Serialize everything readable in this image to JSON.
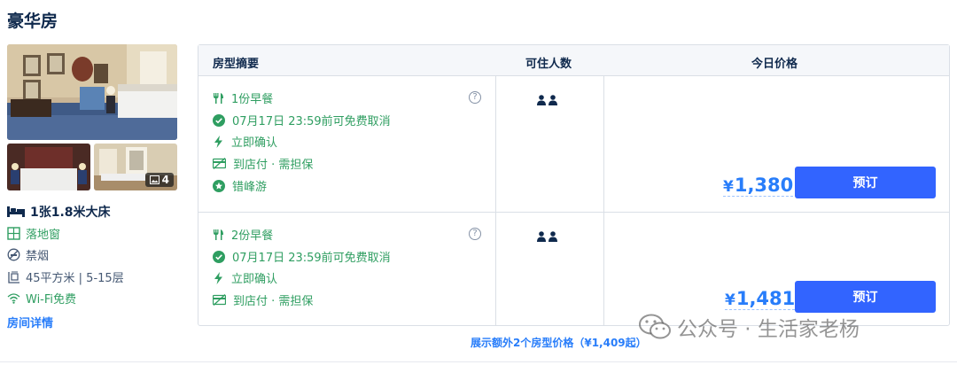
{
  "room": {
    "title": "豪华房",
    "photo_count": "4",
    "bed": "1张1.8米大床",
    "features": [
      {
        "icon": "window-icon",
        "text": "落地窗",
        "color": "#2f9e61"
      },
      {
        "icon": "no-smoking-icon",
        "text": "禁烟",
        "color": "#455873"
      },
      {
        "icon": "area-icon",
        "text": "45平方米 | 5-15层",
        "color": "#455873"
      },
      {
        "icon": "wifi-icon",
        "text": "Wi-Fi免费",
        "color": "#2f9e61"
      }
    ],
    "details_link": "房间详情"
  },
  "table": {
    "headers": {
      "summary": "房型摘要",
      "guests": "可住人数",
      "price": "今日价格"
    },
    "rows": [
      {
        "policies": [
          {
            "icon": "fork-knife-icon",
            "text": "1份早餐"
          },
          {
            "icon": "check-circle-icon",
            "text": "07月17日 23:59前可免费取消"
          },
          {
            "icon": "lightning-icon",
            "text": "立即确认"
          },
          {
            "icon": "no-card-icon",
            "text": "到店付 · 需担保"
          },
          {
            "icon": "star-badge-icon",
            "text": "错峰游"
          }
        ],
        "help": "?",
        "guest_count": 2,
        "currency": "¥",
        "price": "1,380",
        "book_label": "预订"
      },
      {
        "policies": [
          {
            "icon": "fork-knife-icon",
            "text": "2份早餐"
          },
          {
            "icon": "check-circle-icon",
            "text": "07月17日 23:59前可免费取消"
          },
          {
            "icon": "lightning-icon",
            "text": "立即确认"
          },
          {
            "icon": "no-card-icon",
            "text": "到店付 · 需担保"
          }
        ],
        "help": "?",
        "guest_count": 2,
        "currency": "¥",
        "price": "1,481",
        "book_label": "预订"
      }
    ],
    "more_link": "展示额外2个房型价格（¥1,409起）"
  },
  "watermark": {
    "text": "公众号 · 生活家老杨"
  },
  "colors": {
    "accent": "#287dfa",
    "button": "#3264ff",
    "green": "#2f9e61",
    "text": "#0f294d"
  }
}
